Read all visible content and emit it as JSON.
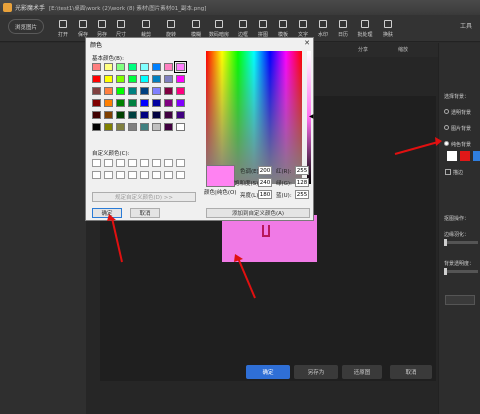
{
  "titlebar": {
    "app_title": "光影魔术手",
    "path": "[E:\\test1\\桌面\\work (2)\\work (8) 素材\\图片素材01_副本.png]"
  },
  "toolbar": {
    "open_label": "浏览图片",
    "items": [
      "打开",
      "保存",
      "另存",
      "尺寸",
      "裁剪",
      "旋转",
      "模糊",
      "数码暗房",
      "边框",
      "拼图",
      "模板",
      "文字",
      "水印",
      "日历",
      "批处理",
      "换肤"
    ],
    "right_items": [
      "分享",
      "工具"
    ]
  },
  "canvas": {
    "share_label": "分享",
    "zoom_label": "缩放"
  },
  "bottom": {
    "confirm": "确定",
    "save_as": "另存为",
    "restore": "还原图",
    "cancel": "取消"
  },
  "right_panel": {
    "section_bg": "选择背景：",
    "transparent": "透明背景",
    "image_bg": "图片背景",
    "solid_bg": "纯色背景",
    "section_edge": "抠图操作：",
    "edge_soft": "边缘羽化：",
    "bg_transparency": "背景透明度：",
    "edge_label": "描边",
    "swatches": [
      "#ffffff",
      "#e01818",
      "#2f7fe0"
    ]
  },
  "dialog": {
    "title": "颜色",
    "basic_label": "基本颜色(B):",
    "custom_label": "自定义颜色(C):",
    "define_custom": "规定自定义颜色(D) >>",
    "ok": "确定",
    "cancel": "取消",
    "color_solid": "颜色|纯色(O)",
    "add_custom": "添加到自定义颜色(A)",
    "hue_label": "色调(E):",
    "hue": "200",
    "sat_label": "饱和度(S):",
    "sat": "240",
    "lum_label": "亮度(L):",
    "lum": "180",
    "red_label": "红(R):",
    "red": "255",
    "green_label": "绿(G):",
    "green": "128",
    "blue_label": "蓝(U):",
    "blue": "255",
    "basic_colors": [
      "#ff8080",
      "#ffff80",
      "#80ff80",
      "#00ff80",
      "#80ffff",
      "#0080ff",
      "#ff80c0",
      "#ff80ff",
      "#ff0000",
      "#ffff00",
      "#80ff00",
      "#00ff40",
      "#00ffff",
      "#0080c0",
      "#8080c0",
      "#ff00ff",
      "#804040",
      "#ff8040",
      "#00ff00",
      "#008080",
      "#004080",
      "#8080ff",
      "#800040",
      "#ff0080",
      "#800000",
      "#ff8000",
      "#008000",
      "#008040",
      "#0000ff",
      "#0000a0",
      "#800080",
      "#8000ff",
      "#400000",
      "#804000",
      "#004000",
      "#004040",
      "#000080",
      "#000040",
      "#400040",
      "#400080",
      "#000000",
      "#808000",
      "#808040",
      "#808080",
      "#408080",
      "#c0c0c0",
      "#400040",
      "#ffffff"
    ],
    "selected_color": "#ff80f2"
  }
}
